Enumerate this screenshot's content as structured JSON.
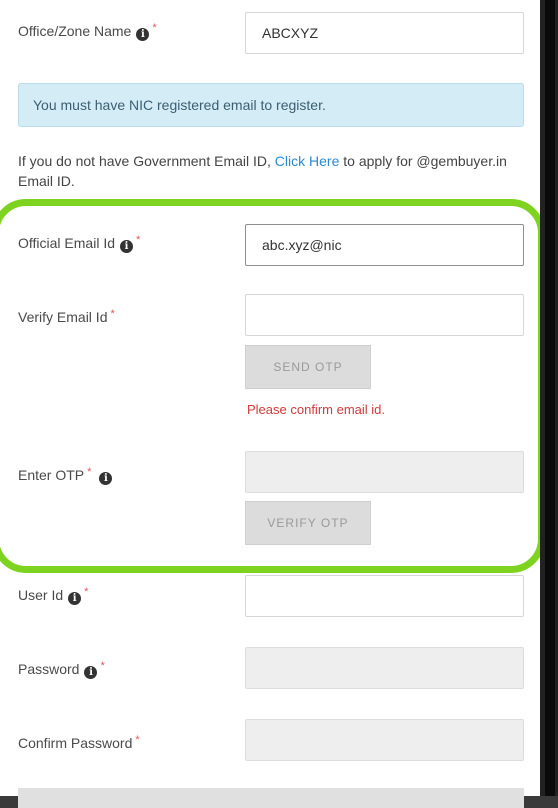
{
  "office_zone": {
    "label": "Office/Zone Name",
    "value": "ABCXYZ"
  },
  "alert": {
    "text": "You must have NIC registered email to register."
  },
  "notice": {
    "before_link": "If you do not have Government Email ID,",
    "link_text": "Click Here",
    "after_link": "to apply for @gembuyer.in Email ID."
  },
  "official_email": {
    "label": "Official Email Id",
    "value": "abc.xyz@nic"
  },
  "verify_email": {
    "label": "Verify Email Id",
    "value": ""
  },
  "send_otp": {
    "label": "SEND OTP"
  },
  "verify_error": {
    "text": "Please confirm email id."
  },
  "otp": {
    "label": "Enter OTP",
    "value": ""
  },
  "verify_otp": {
    "label": "VERIFY OTP"
  },
  "user_id": {
    "label": "User Id",
    "value": ""
  },
  "password": {
    "label": "Password",
    "value": ""
  },
  "confirm_password": {
    "label": "Confirm Password",
    "value": ""
  },
  "required_marker": "*",
  "colors": {
    "highlight": "#7ed321",
    "link": "#2a8ad1",
    "error": "#d03a3a",
    "alert_bg": "#d4ecf6"
  },
  "icons": {
    "info": "info-circle-icon"
  }
}
